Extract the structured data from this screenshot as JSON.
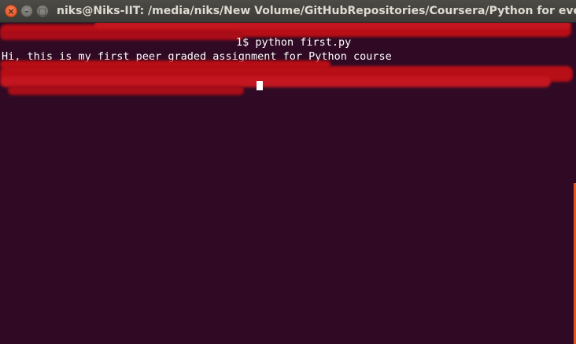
{
  "window": {
    "title": "niks@Niks-IIT: /media/niks/New Volume/GitHubRepositories/Coursera/Python for everybody",
    "close_glyph": "×",
    "minimize_glyph": "–",
    "maximize_glyph": "□"
  },
  "terminal": {
    "lines": [
      {
        "kind": "redacted-prompt",
        "command": "1$ python first.py"
      },
      {
        "kind": "output",
        "text": "Hi, this is my first peer graded assignment for Python course"
      },
      {
        "kind": "redacted-prompt",
        "command": ""
      }
    ],
    "colors": {
      "background": "#300a24",
      "text": "#ffffff",
      "redaction": "#b80e16",
      "scroll_thumb": "#e05a1f"
    }
  }
}
